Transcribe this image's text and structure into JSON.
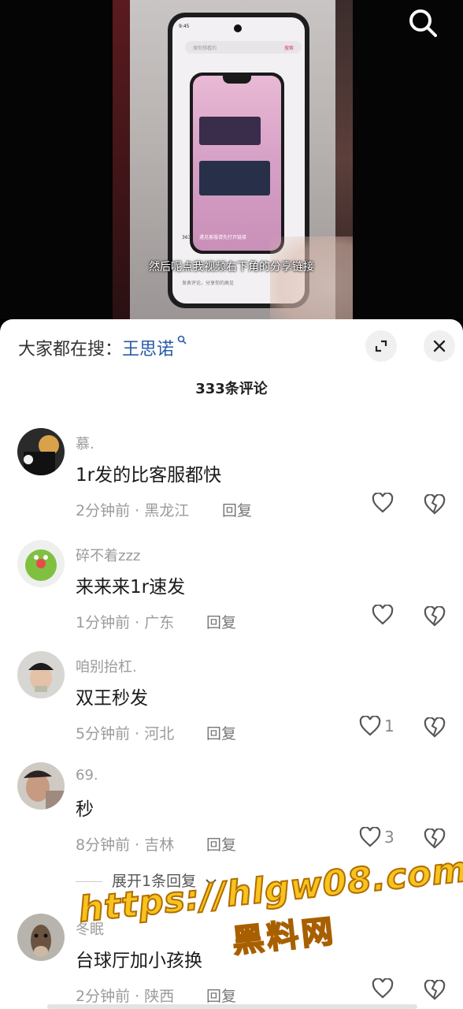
{
  "video": {
    "phone_status_time": "9:45",
    "phone_search_placeholder": "搜你想看的",
    "phone_search_button": "搜索",
    "phone_likes": "363",
    "inner_caption": "遇见客服请先打开链接",
    "subtitle": "然后呢点我视频右下角的分享链接",
    "phone_comment_placeholder": "发表评论，分享你的高见"
  },
  "panel": {
    "trending_prefix": "大家都在搜：",
    "trending_keyword": "王思诺",
    "comment_count_title": "333条评论"
  },
  "comments": [
    {
      "username": "慕.",
      "content": "1r发的比客服都快",
      "time": "2分钟前",
      "location": "黑龙江",
      "reply_label": "回复",
      "likes": ""
    },
    {
      "username": "碎不着zzz",
      "content": "来来来1r速发",
      "time": "1分钟前",
      "location": "广东",
      "reply_label": "回复",
      "likes": ""
    },
    {
      "username": "咱别抬杠.",
      "content": "双王秒发",
      "time": "5分钟前",
      "location": "河北",
      "reply_label": "回复",
      "likes": "1"
    },
    {
      "username": "69.",
      "content": "秒",
      "time": "8分钟前",
      "location": "吉林",
      "reply_label": "回复",
      "likes": "3"
    },
    {
      "username": "冬眠",
      "content": "台球厅加小孩换",
      "time": "2分钟前",
      "location": "陕西",
      "reply_label": "回复",
      "likes": ""
    }
  ],
  "expand_replies": "展开1条回复",
  "watermark": {
    "url": "https://hlgw08.com",
    "name": "黑料网"
  },
  "colors": {
    "keyword_blue": "#2a5aa8",
    "watermark_yellow": "#f7c31d"
  }
}
